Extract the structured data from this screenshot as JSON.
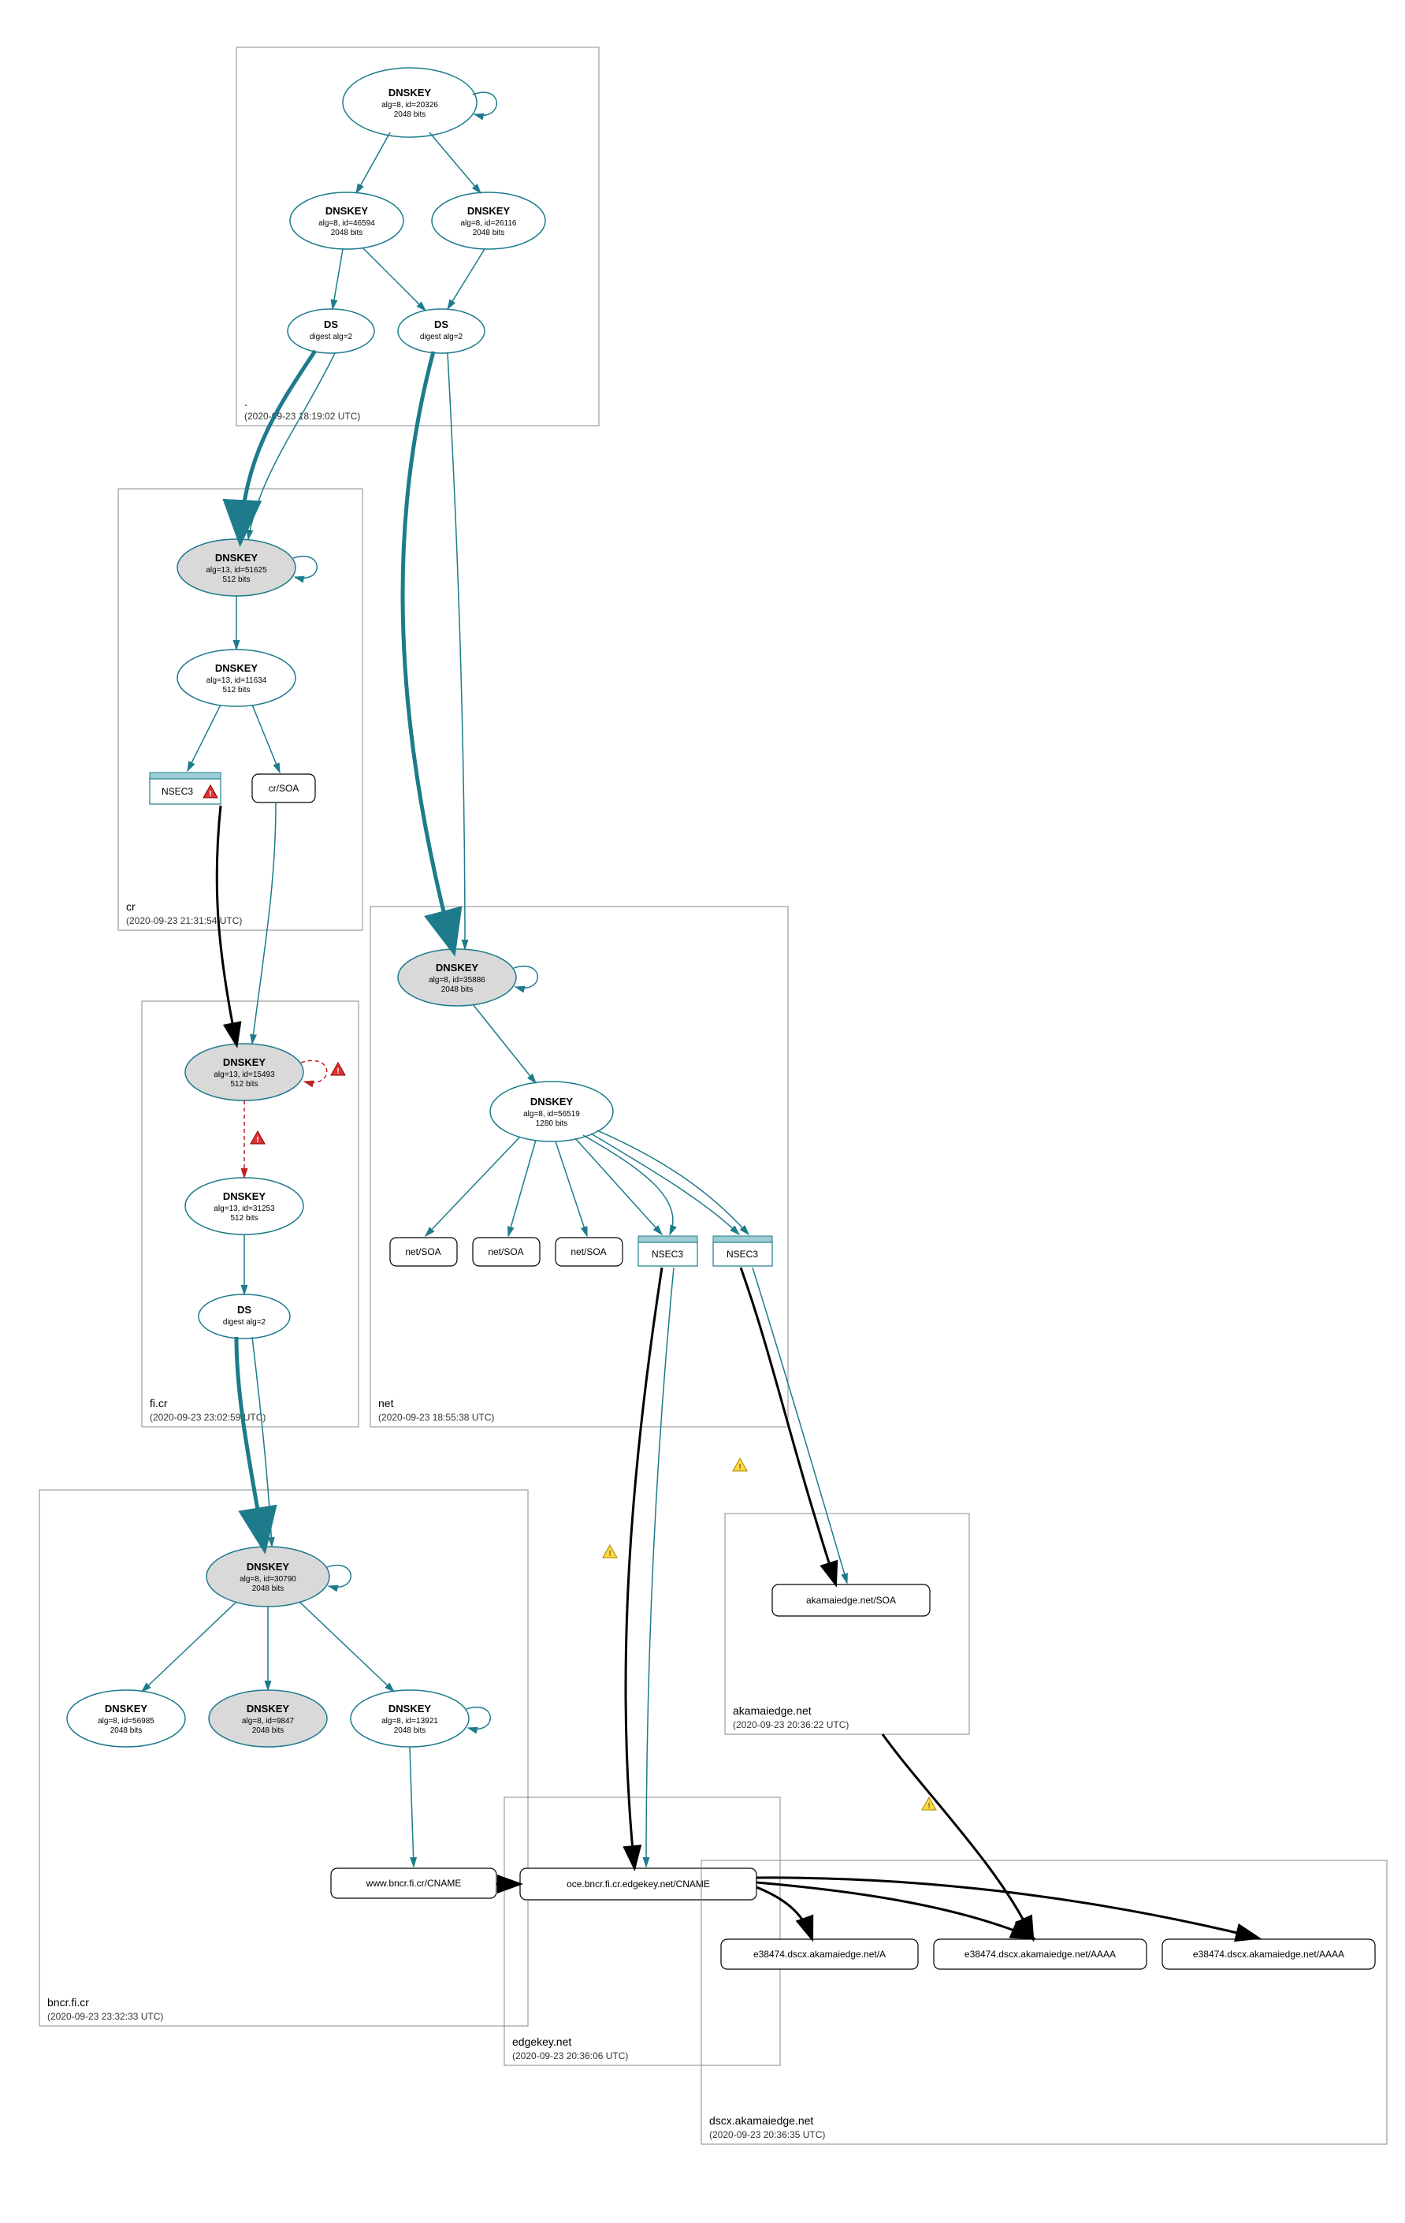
{
  "zones": {
    "root": {
      "label": ".",
      "timestamp": "(2020-09-23 18:19:02 UTC)"
    },
    "cr": {
      "label": "cr",
      "timestamp": "(2020-09-23 21:31:54 UTC)"
    },
    "ficr": {
      "label": "fi.cr",
      "timestamp": "(2020-09-23 23:02:59 UTC)"
    },
    "net": {
      "label": "net",
      "timestamp": "(2020-09-23 18:55:38 UTC)"
    },
    "bncr": {
      "label": "bncr.fi.cr",
      "timestamp": "(2020-09-23 23:32:33 UTC)"
    },
    "akamaiedge": {
      "label": "akamaiedge.net",
      "timestamp": "(2020-09-23 20:36:22 UTC)"
    },
    "edgekey": {
      "label": "edgekey.net",
      "timestamp": "(2020-09-23 20:36:06 UTC)"
    },
    "dscx": {
      "label": "dscx.akamaiedge.net",
      "timestamp": "(2020-09-23 20:36:35 UTC)"
    }
  },
  "nodes": {
    "root_ksk": {
      "title": "DNSKEY",
      "l1": "alg=8, id=20326",
      "l2": "2048 bits"
    },
    "root_zsk1": {
      "title": "DNSKEY",
      "l1": "alg=8, id=46594",
      "l2": "2048 bits"
    },
    "root_zsk2": {
      "title": "DNSKEY",
      "l1": "alg=8, id=26116",
      "l2": "2048 bits"
    },
    "root_ds1": {
      "title": "DS",
      "l1": "digest alg=2"
    },
    "root_ds2": {
      "title": "DS",
      "l1": "digest alg=2"
    },
    "cr_ksk": {
      "title": "DNSKEY",
      "l1": "alg=13, id=51625",
      "l2": "512 bits"
    },
    "cr_zsk": {
      "title": "DNSKEY",
      "l1": "alg=13, id=11634",
      "l2": "512 bits"
    },
    "cr_nsec3": {
      "title": "NSEC3"
    },
    "cr_soa": {
      "title": "cr/SOA"
    },
    "ficr_ksk": {
      "title": "DNSKEY",
      "l1": "alg=13, id=15493",
      "l2": "512 bits"
    },
    "ficr_zsk": {
      "title": "DNSKEY",
      "l1": "alg=13, id=31253",
      "l2": "512 bits"
    },
    "ficr_ds": {
      "title": "DS",
      "l1": "digest alg=2"
    },
    "net_ksk": {
      "title": "DNSKEY",
      "l1": "alg=8, id=35886",
      "l2": "2048 bits"
    },
    "net_zsk": {
      "title": "DNSKEY",
      "l1": "alg=8, id=56519",
      "l2": "1280 bits"
    },
    "net_soa1": {
      "title": "net/SOA"
    },
    "net_soa2": {
      "title": "net/SOA"
    },
    "net_soa3": {
      "title": "net/SOA"
    },
    "net_nsec3a": {
      "title": "NSEC3"
    },
    "net_nsec3b": {
      "title": "NSEC3"
    },
    "bncr_ksk": {
      "title": "DNSKEY",
      "l1": "alg=8, id=30790",
      "l2": "2048 bits"
    },
    "bncr_k1": {
      "title": "DNSKEY",
      "l1": "alg=8, id=56985",
      "l2": "2048 bits"
    },
    "bncr_k2": {
      "title": "DNSKEY",
      "l1": "alg=8, id=9847",
      "l2": "2048 bits"
    },
    "bncr_k3": {
      "title": "DNSKEY",
      "l1": "alg=8, id=13921",
      "l2": "2048 bits"
    },
    "bncr_cname": {
      "title": "www.bncr.fi.cr/CNAME"
    },
    "akamai_soa": {
      "title": "akamaiedge.net/SOA"
    },
    "edgekey_cname": {
      "title": "oce.bncr.fi.cr.edgekey.net/CNAME"
    },
    "dscx_a": {
      "title": "e38474.dscx.akamaiedge.net/A"
    },
    "dscx_aaaa1": {
      "title": "e38474.dscx.akamaiedge.net/AAAA"
    },
    "dscx_aaaa2": {
      "title": "e38474.dscx.akamaiedge.net/AAAA"
    }
  }
}
